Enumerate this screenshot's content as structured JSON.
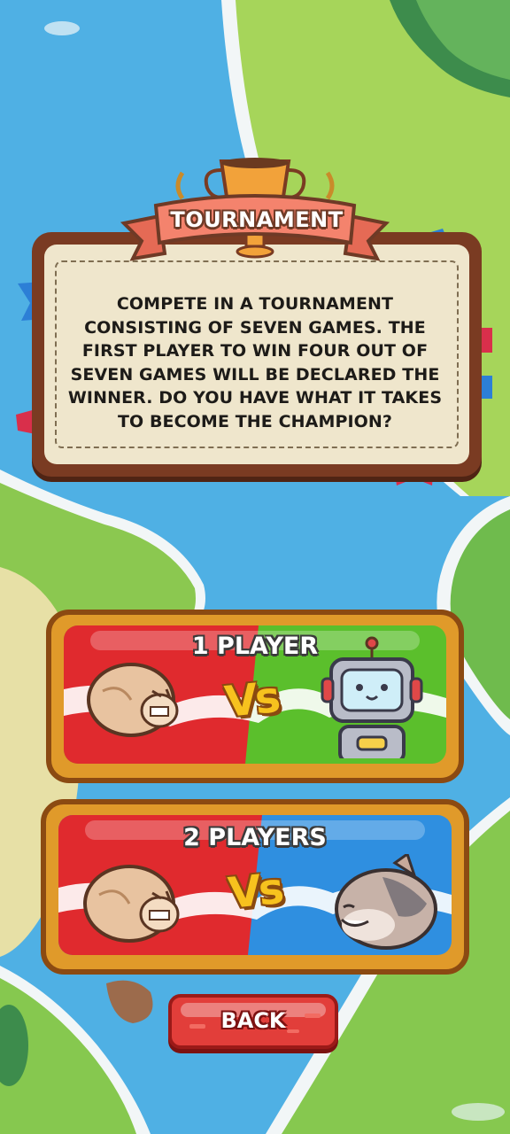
{
  "title": "TOURNAMENT",
  "description": "COMPETE IN A TOURNAMENT CONSISTING OF SEVEN GAMES. THE FIRST PLAYER TO WIN FOUR OUT OF SEVEN GAMES WILL BE DECLARED THE WINNER. DO YOU HAVE WHAT IT TAKES TO BECOME THE CHAMPION?",
  "modes": [
    {
      "label": "1 PLAYER",
      "vs": "Vs",
      "left_character": "hamster-icon",
      "right_character": "robot-icon",
      "left_color": "#e02a2e",
      "right_color": "#5bbf2c"
    },
    {
      "label": "2 PLAYERS",
      "vs": "Vs",
      "left_character": "hamster-icon",
      "right_character": "cat-icon",
      "left_color": "#e02a2e",
      "right_color": "#2f8fe0"
    }
  ],
  "back_button": {
    "label": "BACK"
  },
  "colors": {
    "water": "#4fb0e4",
    "land": "#9ed054",
    "board": "#7a3b22",
    "ribbon": "#f4836d"
  }
}
